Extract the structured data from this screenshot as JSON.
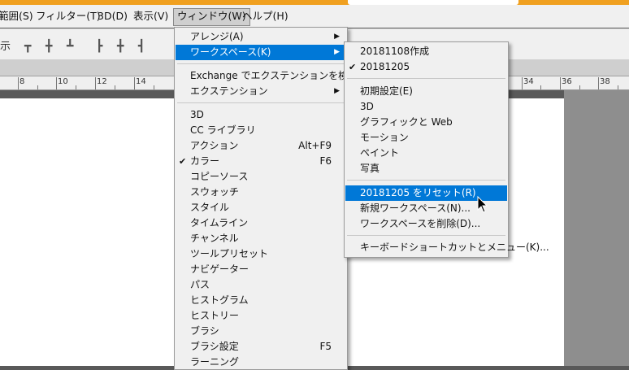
{
  "menubar": {
    "items": [
      {
        "label": "範囲(S)"
      },
      {
        "label": "フィルター(T)"
      },
      {
        "label": "3D(D)"
      },
      {
        "label": "表示(V)"
      },
      {
        "label": "ウィンドウ(W)"
      },
      {
        "label": "ヘルプ(H)"
      }
    ]
  },
  "optionsbar": {
    "left_label": "示"
  },
  "ruler": {
    "labels": [
      "8",
      "10",
      "12",
      "14",
      "34",
      "36",
      "38"
    ]
  },
  "window_menu": {
    "items": [
      {
        "label": "アレンジ(A)",
        "submenu": true
      },
      {
        "label": "ワークスペース(K)",
        "submenu": true
      },
      {
        "label": "Exchange でエクステンションを検索..."
      },
      {
        "label": "エクステンション",
        "submenu": true
      },
      {
        "label": "3D"
      },
      {
        "label": "CC ライブラリ"
      },
      {
        "label": "アクション",
        "shortcut": "Alt+F9"
      },
      {
        "label": "カラー",
        "shortcut": "F6",
        "checked": true
      },
      {
        "label": "コピーソース"
      },
      {
        "label": "スウォッチ"
      },
      {
        "label": "スタイル"
      },
      {
        "label": "タイムライン"
      },
      {
        "label": "チャンネル"
      },
      {
        "label": "ツールプリセット"
      },
      {
        "label": "ナビゲーター"
      },
      {
        "label": "パス"
      },
      {
        "label": "ヒストグラム"
      },
      {
        "label": "ヒストリー"
      },
      {
        "label": "ブラシ"
      },
      {
        "label": "ブラシ設定",
        "shortcut": "F5"
      },
      {
        "label": "ラーニング"
      }
    ]
  },
  "workspace_menu": {
    "items": [
      {
        "label": "20181108作成"
      },
      {
        "label": "20181205",
        "checked": true
      },
      {
        "label": "初期設定(E)"
      },
      {
        "label": "3D"
      },
      {
        "label": "グラフィックと Web"
      },
      {
        "label": "モーション"
      },
      {
        "label": "ペイント"
      },
      {
        "label": "写真"
      },
      {
        "label": "20181205 をリセット(R)"
      },
      {
        "label": "新規ワークスペース(N)..."
      },
      {
        "label": "ワークスペースを削除(D)..."
      },
      {
        "label": "キーボードショートカットとメニュー(K)..."
      }
    ]
  },
  "icons": {
    "submenu_arrow": "▶",
    "checkmark": "✔"
  },
  "colors": {
    "highlight": "#0078d7",
    "menu_bg": "#f0f0f0",
    "title_strip": "#f0a020"
  }
}
